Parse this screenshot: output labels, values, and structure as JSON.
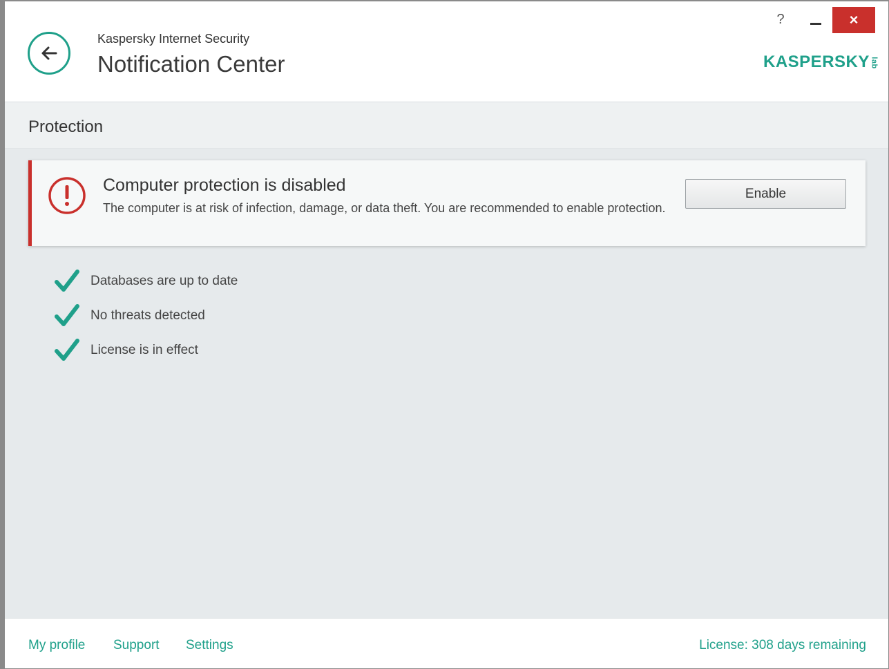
{
  "header": {
    "app_name": "Kaspersky Internet Security",
    "title": "Notification Center",
    "help_label": "?",
    "close_label": "×",
    "logo_text": "KASPERSKY",
    "logo_suffix": "lab"
  },
  "section": {
    "title": "Protection"
  },
  "alert": {
    "title": "Computer protection is disabled",
    "text": "The computer is at risk of infection, damage, or data theft. You are recommended to enable protection.",
    "button_label": "Enable",
    "accent_color": "#c9302c"
  },
  "status_items": [
    {
      "label": "Databases are up to date",
      "icon": "checkmark-icon"
    },
    {
      "label": "No threats detected",
      "icon": "checkmark-icon"
    },
    {
      "label": "License is in effect",
      "icon": "checkmark-icon"
    }
  ],
  "footer": {
    "links": [
      "My profile",
      "Support",
      "Settings"
    ],
    "license_text": "License: 308 days remaining"
  },
  "colors": {
    "brand": "#1fa08a",
    "alert": "#c9302c"
  }
}
